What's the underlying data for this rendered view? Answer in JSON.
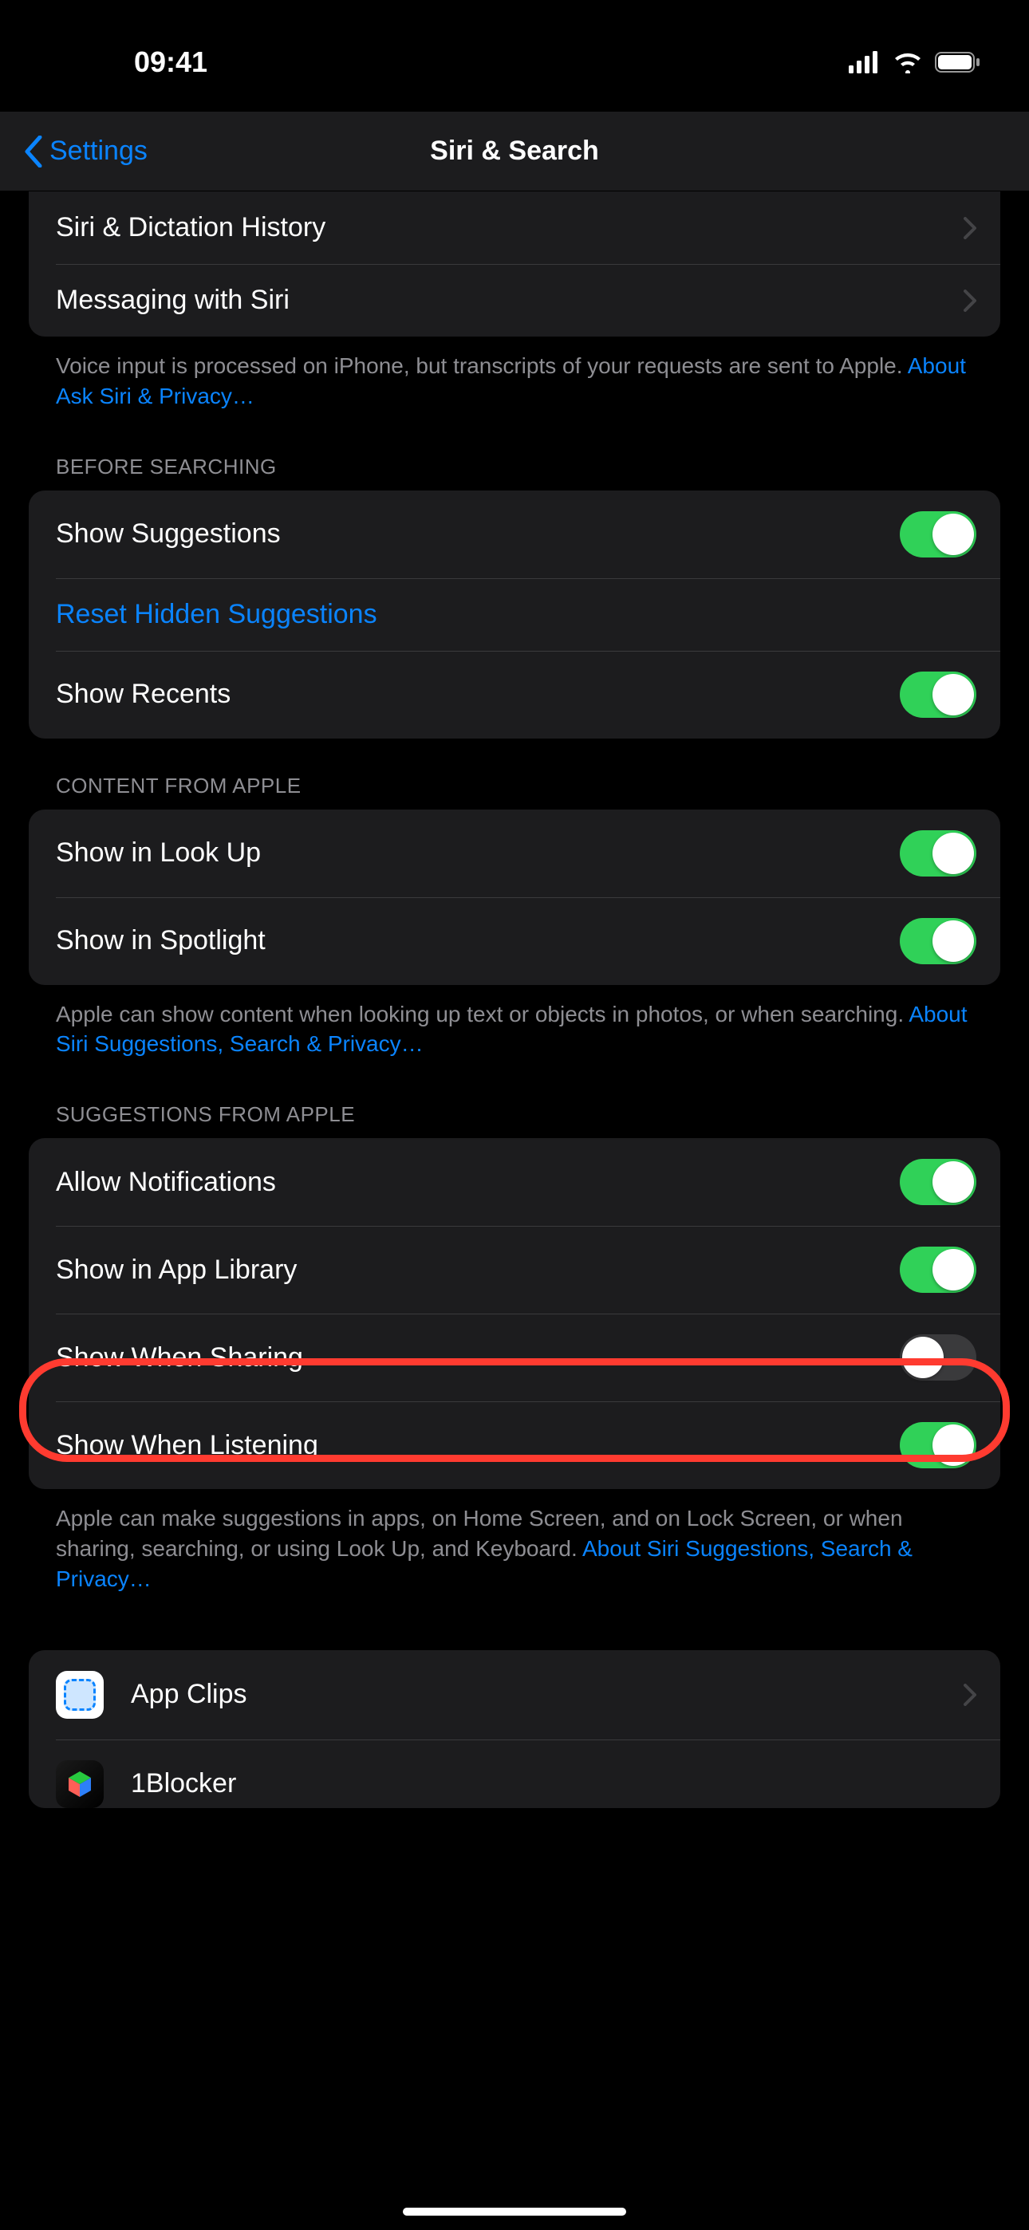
{
  "status": {
    "time": "09:41"
  },
  "nav": {
    "back": "Settings",
    "title": "Siri & Search"
  },
  "top_group": {
    "history": "Siri & Dictation History",
    "messaging": "Messaging with Siri"
  },
  "top_footer": {
    "text": "Voice input is processed on iPhone, but transcripts of your requests are sent to Apple. ",
    "link": "About Ask Siri & Privacy…"
  },
  "before_searching": {
    "header": "Before Searching",
    "show_suggestions": {
      "label": "Show Suggestions",
      "on": true
    },
    "reset_hidden": "Reset Hidden Suggestions",
    "show_recents": {
      "label": "Show Recents",
      "on": true
    }
  },
  "content_from_apple": {
    "header": "Content From Apple",
    "look_up": {
      "label": "Show in Look Up",
      "on": true
    },
    "spotlight": {
      "label": "Show in Spotlight",
      "on": true
    },
    "footer_text": "Apple can show content when looking up text or objects in photos, or when searching. ",
    "footer_link": "About Siri Suggestions, Search & Privacy…"
  },
  "suggestions_from_apple": {
    "header": "Suggestions From Apple",
    "allow_notifications": {
      "label": "Allow Notifications",
      "on": true
    },
    "app_library": {
      "label": "Show in App Library",
      "on": true
    },
    "when_sharing": {
      "label": "Show When Sharing",
      "on": false
    },
    "when_listening": {
      "label": "Show When Listening",
      "on": true
    },
    "footer_text": "Apple can make suggestions in apps, on Home Screen, and on Lock Screen, or when sharing, searching, or using Look Up, and Keyboard. ",
    "footer_link": "About Siri Suggestions, Search & Privacy…"
  },
  "apps": {
    "app_clips": "App Clips",
    "blocker": "1Blocker"
  }
}
